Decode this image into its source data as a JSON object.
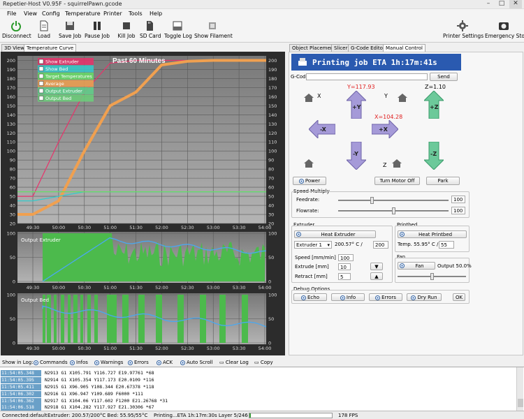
{
  "window": {
    "title": "Repetier-Host V0.95F - squirrelPawn.gcode",
    "min": "–",
    "max": "□",
    "close": "✕"
  },
  "menu": [
    "File",
    "View",
    "Config",
    "Temperature",
    "Printer",
    "Tools",
    "Help"
  ],
  "toolbar": {
    "disconnect": "Disconnect",
    "load": "Load",
    "save_job": "Save Job",
    "pause_job": "Pause Job",
    "kill_job": "Kill Job",
    "sd_card": "SD Card",
    "toggle_log": "Toggle Log",
    "show_filament": "Show Filament",
    "printer_settings": "Printer Settings",
    "emergency_stop": "Emergency Stop"
  },
  "left_tabs": [
    "3D View",
    "Temperature Curve"
  ],
  "right_tabs": [
    "Object Placement",
    "Slicer",
    "G-Code Editor",
    "Manual Control"
  ],
  "temp_chart": {
    "title": "Past 60 Minutes",
    "legend": [
      {
        "label": "Show Extruder",
        "color": "#e8336b"
      },
      {
        "label": "Show Bed",
        "color": "#33cccc"
      },
      {
        "label": "Target Temperatures",
        "color": "#66dd66"
      },
      {
        "label": "Average",
        "color": "#f0a050"
      },
      {
        "label": "Output Extruder",
        "color": "#5fd08a"
      },
      {
        "label": "Output Bed",
        "color": "#6bd07a"
      }
    ],
    "y_ticks": [
      "200",
      "190",
      "180",
      "170",
      "160",
      "150",
      "140",
      "130",
      "120",
      "110",
      "100",
      "90",
      "80",
      "70",
      "60",
      "50",
      "40",
      "30",
      "20"
    ],
    "x_ticks": [
      "49:30",
      "50:00",
      "50:30",
      "51:00",
      "51:30",
      "52:00",
      "52:30",
      "53:00",
      "53:30",
      "54:00"
    ],
    "out_ticks": [
      "100",
      "50",
      "0"
    ],
    "out_extruder_label": "Output Extruder",
    "out_bed_label": "Output Bed"
  },
  "chart_data": {
    "type": "line",
    "title": "Past 60 Minutes",
    "x": [
      "49:30",
      "50:00",
      "50:30",
      "51:00",
      "51:30",
      "52:00",
      "52:30",
      "53:00",
      "53:30",
      "54:00"
    ],
    "ylim": [
      20,
      205
    ],
    "series": [
      {
        "name": "Show Extruder",
        "values": [
          50,
          110,
          165,
          197,
          200,
          200,
          200,
          200,
          200,
          200
        ]
      },
      {
        "name": "Average",
        "values": [
          30,
          45,
          100,
          150,
          165,
          195,
          199,
          200,
          200,
          200
        ]
      },
      {
        "name": "Show Bed",
        "values": [
          45,
          50,
          55,
          55,
          55,
          55,
          55,
          55,
          55,
          55
        ]
      },
      {
        "name": "Target Temperatures",
        "values": [
          55,
          55,
          55,
          55,
          55,
          55,
          55,
          55,
          55,
          55
        ]
      }
    ]
  },
  "manual": {
    "banner": "Printing job ETA 1h:17m:41s",
    "gcode_label": "G-Code:",
    "send": "Send",
    "x_label": "X",
    "y_label": "Y",
    "z_label": "Z",
    "y_pos": "Y=117.93",
    "z_pos": "Z=1.10",
    "x_pos": "X=104.28",
    "py": "+Y",
    "my": "-Y",
    "px": "+X",
    "mx": "-X",
    "pz": "+Z",
    "mz": "-Z",
    "power": "Power",
    "turn_motor_off": "Turn Motor Off",
    "park": "Park",
    "speed_multiply": "Speed Multiply",
    "feedrate": "Feedrate:",
    "feedrate_val": "100",
    "feedrate_level": 0.3,
    "flowrate": "Flowrate:",
    "flowrate_val": "100",
    "flowrate_level": 0.5,
    "extruder_grp": "Extruder",
    "heat_extruder": "Heat Extruder",
    "extruder_sel": "Extruder 1",
    "extruder_temp": "200.57° C /",
    "extruder_target": "200",
    "speed_label": "Speed [mm/min]",
    "speed_val": "100",
    "extrude_label": "Extrude [mm]",
    "extrude_val": "10",
    "retract_label": "Retract [mm]",
    "retract_val": "5",
    "printbed_grp": "Printbed",
    "heat_printbed": "Heat Printbed",
    "bed_temp": "Temp. 55.95° C /",
    "bed_target": "55",
    "fan_grp": "Fan",
    "fan": "Fan",
    "fan_output": "Output 50.0%",
    "fan_level": 0.5,
    "debug_grp": "Debug Options",
    "echo": "Echo",
    "info": "Info",
    "errors": "Errors",
    "dry_run": "Dry Run",
    "ok": "OK"
  },
  "log_toolbar": [
    "Show in Log:",
    "Commands",
    "Infos",
    "Warnings",
    "Errors",
    "ACK",
    "Auto Scroll",
    "Clear Log",
    "Copy"
  ],
  "log": [
    {
      "t": "11:54:05.348",
      "c": "N2913 G1 X105.791 Y116.727 E19.97761 *68"
    },
    {
      "t": "11:54:05.395",
      "c": "N2914 G1 X105.354 Y117.173 E20.0109 *116"
    },
    {
      "t": "11:54:05.411",
      "c": "N2915 G1 X96.905 Y108.344 E20.67378 *118"
    },
    {
      "t": "11:54:06.302",
      "c": "N2916 G1 X96.947 Y109.689 F6000 *111"
    },
    {
      "t": "11:54:06.362",
      "c": "N2917 G1 X104.06 Y117.602 F1200 E21.26768 *31"
    },
    {
      "t": "11:54:06.518",
      "c": "N2918 G1 X104.282 Y117.927 E21.30306 *67"
    }
  ],
  "status": {
    "conn": "Connected:default",
    "temps": "Extruder: 200.57/200°C Bed: 55.95/55°C",
    "job": "Printing...ETA 1h:17m:30s Layer 5/246",
    "progress": 0.02,
    "fps": "178 FPS"
  }
}
